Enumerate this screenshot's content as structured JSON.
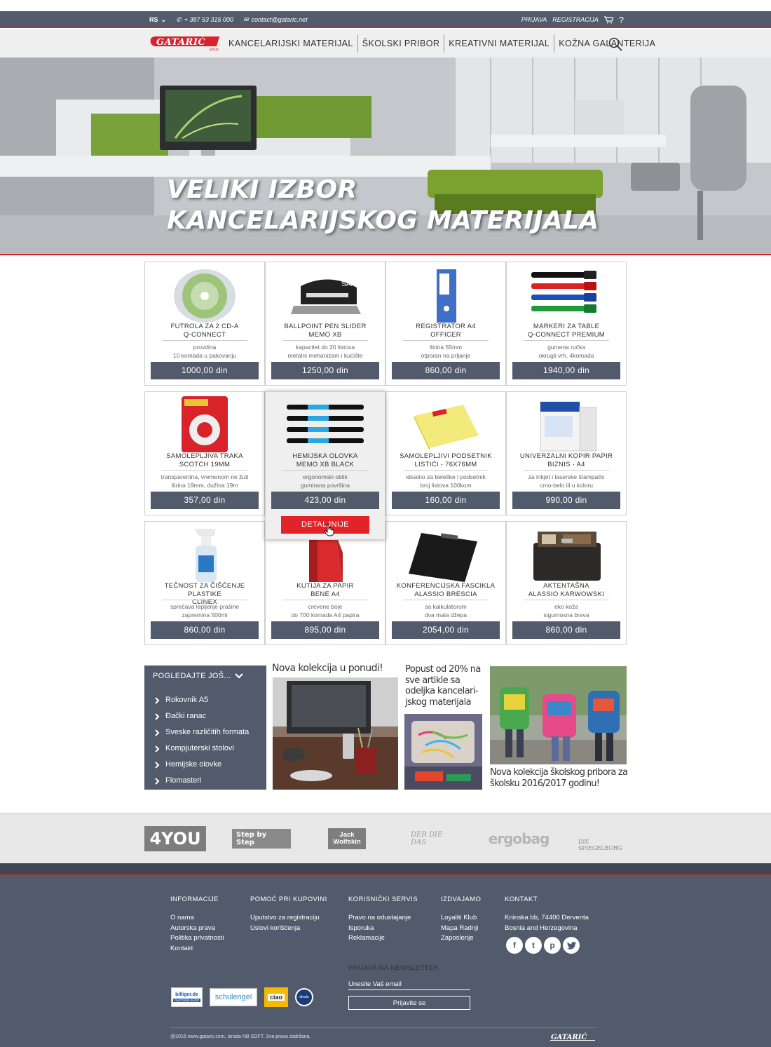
{
  "topbar": {
    "lang": "RS",
    "phone": "+ 387 53 315 000",
    "email": "contact@gataric.net",
    "login": "PRIJAVA",
    "register": "REGISTRACIJA",
    "help": "?"
  },
  "nav": {
    "logo": "GATARIĆ",
    "logo_sub": "group",
    "items": [
      "KANCELARIJSKI MATERIJAL",
      "ŠKOLSKI PRIBOR",
      "KREATIVNI MATERIJAL",
      "KOŽNA GALANTERIJA"
    ]
  },
  "hero": {
    "line1": "VELIKI IZBOR",
    "line2": "KANCELARIJSKOG MATERIJALA"
  },
  "products": [
    {
      "name1": "FUTROLA ZA 2 CD-A",
      "name2": "Q-CONNECT",
      "desc1": "provdina",
      "desc2": "10 komada u pakovanju",
      "price": "1000,00 din",
      "icon": "cd-case-icon"
    },
    {
      "name1": "BALLPOINT PEN SLIDER",
      "name2": "MEMO XB",
      "desc1": "kapacitet do 20 listova",
      "desc2": "metalni mehanizam i kućište",
      "price": "1250,00 din",
      "icon": "hole-punch-icon"
    },
    {
      "name1": "REGISTRATOR A4",
      "name2": "OFFICER",
      "desc1": "širina 55mm",
      "desc2": "otporan na prljanje",
      "price": "860,00 din",
      "icon": "binder-icon"
    },
    {
      "name1": "MARKERI ZA TABLE",
      "name2": "Q-CONNECT PREMIUM",
      "desc1": "gumena ručka",
      "desc2": "okrugli vrh, 4komada",
      "price": "1940,00 din",
      "icon": "markers-icon"
    },
    {
      "name1": "SAMOLEPLJIVA TRAKA",
      "name2": "SCOTCH 19mm",
      "desc1": "transparentna, vremenom ne žuti",
      "desc2": "širina 19mm, dužina 19m",
      "price": "357,00 din",
      "icon": "tape-icon"
    },
    {
      "name1": "HEMIJSKA OLOVKA",
      "name2": "MEMO XB BLACK",
      "desc1": "ergonomski oblik",
      "desc2": "gumirana površina",
      "price": "423,00 din",
      "icon": "pens-icon"
    },
    {
      "name1": "SAMOLEPLJIVI PODSETNIK",
      "name2": "LISTIĆI - 76X76mm",
      "desc1": "idealno za beleške i podsetnik",
      "desc2": "broj listova 100kom",
      "price": "160,00 din",
      "icon": "sticky-notes-icon"
    },
    {
      "name1": "UNIVERZALNI KOPIR PAPIR",
      "name2": "BIZNIS - A4",
      "desc1": "za inkjet i laserske štampače",
      "desc2": "crno-belo ili u koloru",
      "price": "990,00 din",
      "icon": "paper-box-icon"
    },
    {
      "name1": "TEČNOST ZA ČIŠĆENJE PLASTIKE",
      "name2": "CLINEX",
      "desc1": "sprečava lepljenje prašine",
      "desc2": "zapremina 500ml",
      "price": "860,00 din",
      "icon": "spray-bottle-icon"
    },
    {
      "name1": "KUTIJA ZA PAPIR",
      "name2": "BENE A4",
      "desc1": "crevene boje",
      "desc2": "do 700 komada A4 papira",
      "price": "895,00 din",
      "icon": "magazine-file-icon"
    },
    {
      "name1": "KONFERENCIJSKA FASCIKLA",
      "name2": "ALASSIO BRESCIA",
      "desc1": "sa kalkulatorom",
      "desc2": "dva mala džepa",
      "price": "2054,00 din",
      "icon": "folder-icon"
    },
    {
      "name1": "AKTENTAŠNA",
      "name2": "ALASSIO KARWOWSKI",
      "desc1": "eko koža",
      "desc2": "sigurnosna brava",
      "price": "860,00 din",
      "icon": "briefcase-icon"
    }
  ],
  "detail_label": "DETALJNIJE",
  "sidebar": {
    "title": "POGLEDAJTE JOŠ...",
    "items": [
      "Rokovnik A5",
      "Đački ranac",
      "Sveske različitih formata",
      "Kompjuterski stolovi",
      "Hemijske olovke",
      "Flomasteri"
    ]
  },
  "promos": {
    "p1": "Nova kolekcija u ponudi!",
    "p2a": "Popust od 20% na",
    "p2b": "sve artikle sa",
    "p2c": "odeljka kancelari-",
    "p2d": "jskog materijala",
    "p3a": "Nova kolekcija školskog pribora  za",
    "p3b": "školsku 2016/2017 godinu!"
  },
  "brands": [
    "4YOU",
    "Step by Step",
    "Jack Wolfskin",
    "DER DIE DAS",
    "ergobag",
    "DIE SPIEGELBURG"
  ],
  "footer": {
    "col1": {
      "title": "INFORMACIJE",
      "links": [
        "O nama",
        "Autorska prava",
        "Politika privatnosti",
        "Kontakt"
      ]
    },
    "col2": {
      "title": "POMOĆ PRI KUPOVINI",
      "links": [
        "Uputstvo za registraciju",
        "Uslovi korišćenja"
      ]
    },
    "col3": {
      "title": "KORISNIČKI SERVIS",
      "links": [
        "Pravo na odustajanje",
        "Isporuka",
        "Reklamacije"
      ]
    },
    "col4": {
      "title": "IZDVAJAMO",
      "links": [
        "Loyaliti Klub",
        "Mapa Radnji",
        "Zaposlenje"
      ]
    },
    "col5": {
      "title": "KONTAKT",
      "lines": [
        "Kninska bb, 74400 Derventa",
        "Bosnia and Herzegovina"
      ]
    },
    "social": [
      "f",
      "t",
      "p",
      "tw"
    ],
    "newsletter_title": "PRIJAVA NA NEWSLETTER",
    "newsletter_placeholder": "Unesite Vaš email",
    "newsletter_button": "Prijavite se",
    "badges": [
      "billiger.de",
      "schulengel",
      "ciao",
      "idealo"
    ],
    "badge_sub": "PARTNER-SHOP",
    "copyright": "@2016 www.gataric.com, Izrada NB SOFT. Sva prava zadržana.",
    "logo": "GATARIĆ"
  }
}
